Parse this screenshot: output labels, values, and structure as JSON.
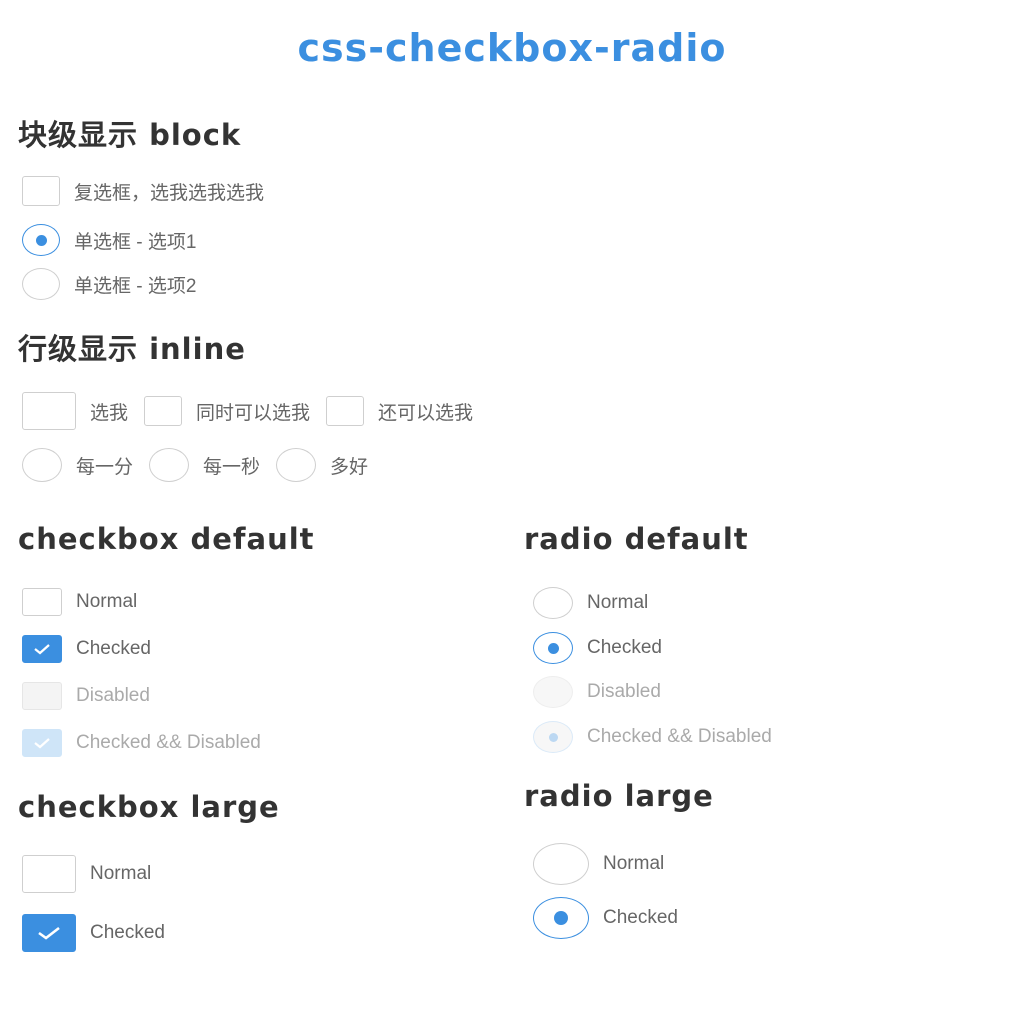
{
  "title": "css-checkbox-radio",
  "block_section": {
    "heading": "块级显示 block",
    "checkbox_label": "复选框，选我选我选我",
    "radio1_label": "单选框 - 选项1",
    "radio2_label": "单选框 - 选项2"
  },
  "inline_section": {
    "heading": "行级显示 inline",
    "checkboxes": [
      "选我",
      "同时可以选我",
      "还可以选我"
    ],
    "radios": [
      "每一分",
      "每一秒",
      "多好"
    ]
  },
  "checkbox_default": {
    "heading": "checkbox default",
    "items": [
      {
        "label": "Normal",
        "checked": false,
        "disabled": false
      },
      {
        "label": "Checked",
        "checked": true,
        "disabled": false
      },
      {
        "label": "Disabled",
        "checked": false,
        "disabled": true
      },
      {
        "label": "Checked && Disabled",
        "checked": true,
        "disabled": true
      }
    ]
  },
  "radio_default": {
    "heading": "radio default",
    "items": [
      {
        "label": "Normal",
        "checked": false,
        "disabled": false
      },
      {
        "label": "Checked",
        "checked": true,
        "disabled": false
      },
      {
        "label": "Disabled",
        "checked": false,
        "disabled": true
      },
      {
        "label": "Checked && Disabled",
        "checked": true,
        "disabled": true
      }
    ]
  },
  "checkbox_large": {
    "heading": "checkbox large",
    "items": [
      {
        "label": "Normal",
        "checked": false
      },
      {
        "label": "Checked",
        "checked": true
      }
    ]
  },
  "radio_large": {
    "heading": "radio large",
    "items": [
      {
        "label": "Normal",
        "checked": false
      },
      {
        "label": "Checked",
        "checked": true
      }
    ]
  },
  "colors": {
    "accent": "#3b8fe0",
    "heading": "#333333",
    "label": "#666666",
    "border": "#cfcfcf"
  },
  "icons": {
    "check": "check-icon",
    "radio_dot": "radio-dot-icon"
  }
}
